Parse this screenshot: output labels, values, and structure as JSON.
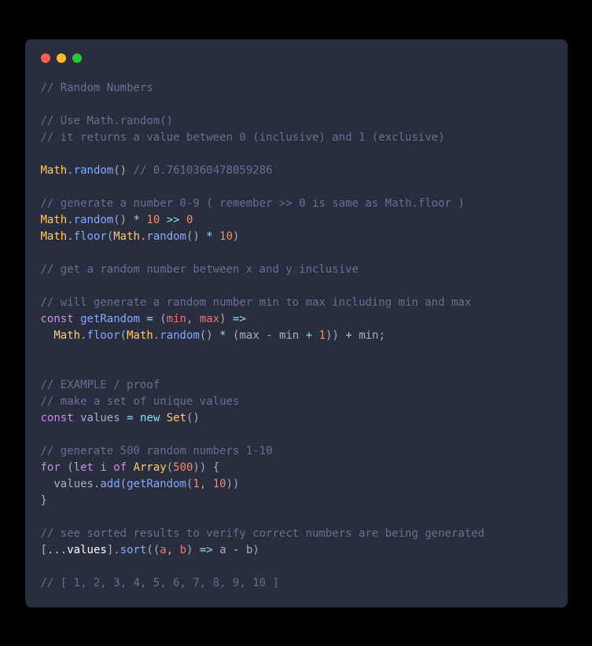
{
  "code": {
    "c1": "// Random Numbers",
    "c2": "// Use Math.random()",
    "c3": "// it returns a value between 0 (inclusive) and 1 (exclusive)",
    "Math": "Math",
    "dot": ".",
    "random": "random",
    "lp": "(",
    "rp": ")",
    "sp": " ",
    "c4": "// 0.7610360478059286",
    "c5": "// generate a number 0-9 ( remember >> 0 is same as Math.floor )",
    "star": "*",
    "n10": "10",
    "shr": ">>",
    "n0": "0",
    "floor": "floor",
    "c6": "// get a random number between x and y inclusive",
    "c7": "// will generate a random number min to max including min and max",
    "const": "const",
    "getRandom": "getRandom",
    "eq": "=",
    "min": "min",
    "max": "max",
    "comma": ",",
    "arrow": "=>",
    "minus": "-",
    "plus": "+",
    "n1": "1",
    "semi": ";",
    "c8": "// EXAMPLE / proof",
    "c9": "// make a set of unique values",
    "values": "values",
    "new": "new",
    "Set": "Set",
    "c10": "// generate 500 random numbers 1-10",
    "for": "for",
    "let": "let",
    "i": "i",
    "of": "of",
    "Array": "Array",
    "n500": "500",
    "lb": "{",
    "rb": "}",
    "add": "add",
    "c11": "// see sorted results to verify correct numbers are being generated",
    "lbr": "[",
    "rbr": "]",
    "spread": "...",
    "sort": "sort",
    "a": "a",
    "b": "b",
    "c12": "// [ 1, 2, 3, 4, 5, 6, 7, 8, 9, 10 ]",
    "indent": "  "
  }
}
